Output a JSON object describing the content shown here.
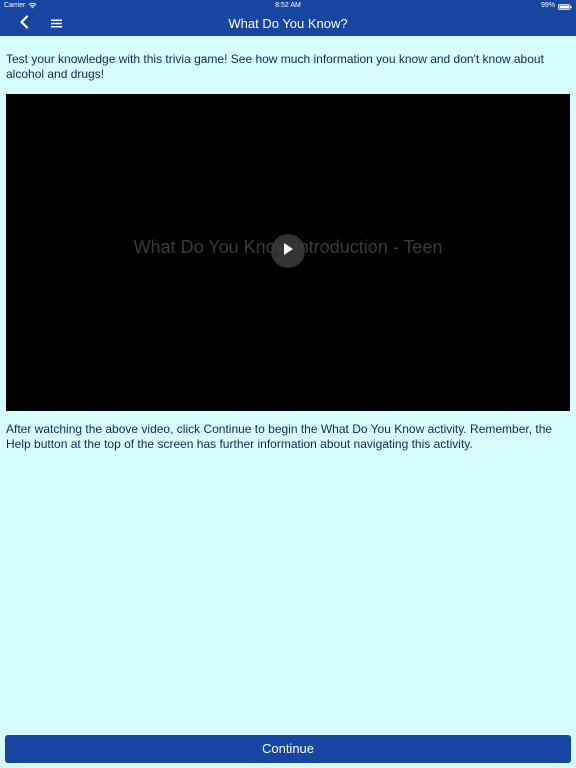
{
  "status_bar": {
    "carrier": "Carrier",
    "time": "8:52 AM",
    "battery": "99%",
    "wifi_icon": "wifi-icon",
    "battery_icon": "battery-icon"
  },
  "nav": {
    "title": "What Do You Know?",
    "back_icon": "chevron-left-icon",
    "menu_icon": "hamburger-menu-icon"
  },
  "intro": {
    "text": "Test your knowledge with this trivia game! See how much information you know and don't know about alcohol and drugs!"
  },
  "video": {
    "title": "What Do You Know Introduction - Teen",
    "play_icon": "play-icon"
  },
  "after": {
    "text": "After watching the above video, click Continue to begin the What Do You Know activity. Remember, the Help button at the top of the screen has further information about navigating this activity."
  },
  "footer": {
    "continue_label": "Continue"
  },
  "colors": {
    "header_blue": "#1746a2",
    "page_background": "#d8fdfd",
    "body_text": "#0e2a5a",
    "video_background": "#000000"
  }
}
